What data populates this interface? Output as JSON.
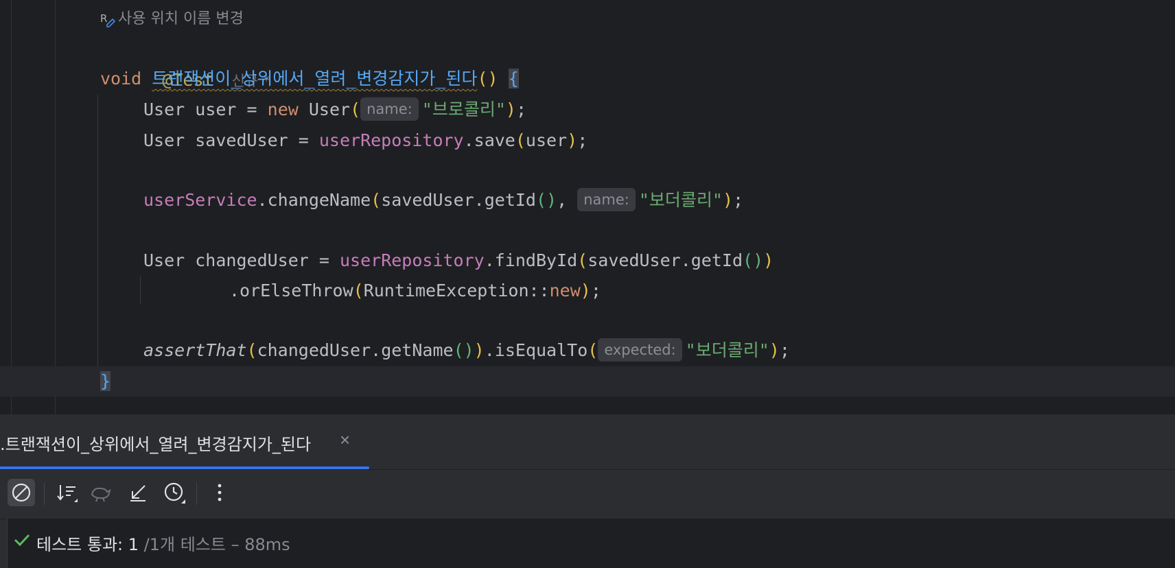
{
  "editor": {
    "usage_hint": "사용 위치 이름 변경",
    "annotation": "@Test",
    "author_hint": "신규 *",
    "method": {
      "return_kw": "void",
      "name": "트랜잭션이_상위에서_열려_변경감지가_된다",
      "parens": "()",
      "open_brace": "{",
      "close_brace": "}"
    },
    "line1": {
      "type": "User",
      "var": " user = ",
      "kw_new": "new",
      "ctor": " User",
      "lp": "(",
      "hint": "name:",
      "arg": "\"브로콜리\"",
      "rp": ")",
      "end": ";"
    },
    "line2": {
      "pre": "User savedUser = ",
      "field": "userRepository",
      "call": ".save",
      "lp": "(",
      "arg": "user",
      "rp": ")",
      "end": ";"
    },
    "line3": {
      "field": "userService",
      "call": ".changeName",
      "lp": "(",
      "arg1": "savedUser.getId",
      "inner": "()",
      "sep": ", ",
      "hint": "name:",
      "arg2": "\"보더콜리\"",
      "rp": ")",
      "end": ";"
    },
    "line4": {
      "pre": "User changedUser = ",
      "field": "userRepository",
      "call": ".findById",
      "lp": "(",
      "arg": "savedUser.getId",
      "inner": "()",
      "rp": ")"
    },
    "line5": {
      "call": ".orElseThrow",
      "lp": "(",
      "arg": "RuntimeException::",
      "kw_new": "new",
      "rp": ")",
      "end": ";"
    },
    "line6": {
      "fn": "assertThat",
      "lp": "(",
      "arg": "changedUser.getName",
      "inner": "()",
      "rp": ")",
      "call": ".isEqualTo",
      "lp2": "(",
      "hint": "expected:",
      "arg2": "\"보더콜리\"",
      "rp2": ")",
      "end": ";"
    }
  },
  "run_panel": {
    "tab_title": ".트랜잭션이_상위에서_열려_변경감지가_된다",
    "close_icon": "×",
    "toolbar_icons": [
      "stop-icon",
      "sort-icon",
      "import-tests-icon",
      "collapse-icon",
      "history-icon",
      "more-icon"
    ],
    "status_main": "테스트 통과: 1",
    "status_sub": " /1개 테스트 – 88ms"
  },
  "colors": {
    "keyword": "#cf8e6d",
    "annotation": "#b3ae60",
    "method": "#56a8f5",
    "field": "#c77dbb",
    "string": "#6aab73",
    "accent": "#3574f0",
    "success": "#5fb865"
  }
}
